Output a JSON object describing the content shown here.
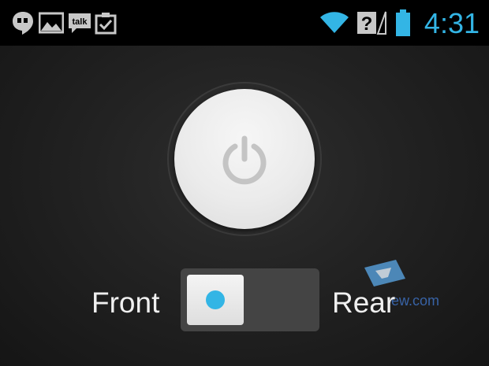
{
  "status_bar": {
    "icons": [
      "hangouts-icon",
      "gallery-icon",
      "talk-icon",
      "task-icon",
      "wifi-icon",
      "no-sim-icon",
      "battery-icon"
    ],
    "talk_label": "talk",
    "clock": "4:31",
    "clock_color": "#33b5e5"
  },
  "main": {
    "power_icon": "power-icon",
    "switch": {
      "left_label": "Front",
      "right_label": "Rear",
      "selected": "Front",
      "accent_color": "#33b5e5"
    }
  },
  "watermark": {
    "text": "ew.com"
  }
}
